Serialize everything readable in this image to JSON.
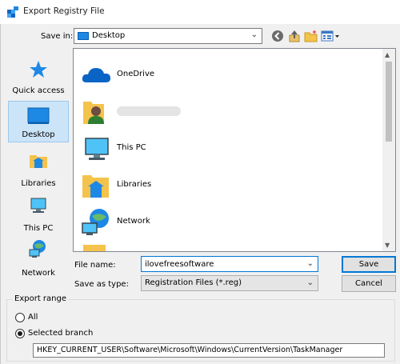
{
  "window": {
    "title": "Export Registry File"
  },
  "toolbar": {
    "save_in_label": "Save in:",
    "save_in_value": "Desktop",
    "back_icon": "back-arrow-icon",
    "up_icon": "up-folder-icon",
    "new_folder_icon": "new-folder-icon",
    "view_icon": "view-menu-icon"
  },
  "places": [
    {
      "label": "Quick access",
      "icon": "star-icon"
    },
    {
      "label": "Desktop",
      "icon": "desktop-icon",
      "selected": true
    },
    {
      "label": "Libraries",
      "icon": "libraries-icon"
    },
    {
      "label": "This PC",
      "icon": "pc-icon"
    },
    {
      "label": "Network",
      "icon": "network-icon"
    }
  ],
  "files": [
    {
      "name": "OneDrive",
      "icon": "onedrive-cloud-icon"
    },
    {
      "name": "",
      "icon": "user-folder-icon"
    },
    {
      "name": "This PC",
      "icon": "pc-icon"
    },
    {
      "name": "Libraries",
      "icon": "libraries-icon"
    },
    {
      "name": "Network",
      "icon": "network-icon"
    }
  ],
  "form": {
    "file_name_label": "File name:",
    "file_name_value": "ilovefreesoftware",
    "save_as_type_label": "Save as type:",
    "save_as_type_value": "Registration Files (*.reg)",
    "save_button": "Save",
    "cancel_button": "Cancel"
  },
  "export_range": {
    "title": "Export range",
    "all_label": "All",
    "selected_branch_label": "Selected branch",
    "selected": "Selected branch",
    "branch_value": "HKEY_CURRENT_USER\\Software\\Microsoft\\Windows\\CurrentVersion\\TaskManager"
  },
  "colors": {
    "accent": "#0078d7",
    "selection": "#cce4f7",
    "dialog_bg": "#f0f0f0"
  }
}
